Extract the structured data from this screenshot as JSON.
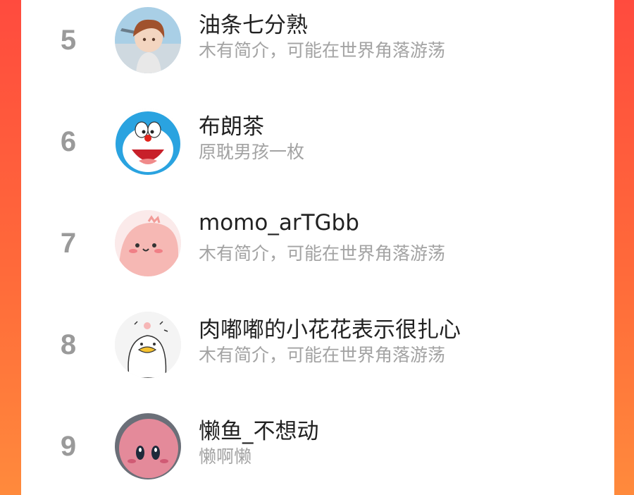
{
  "rankings": [
    {
      "rank": "5",
      "name": "油条七分熟",
      "bio": "木有简介，可能在世界角落游荡",
      "avatar_icon": "anime-boy-avatar"
    },
    {
      "rank": "6",
      "name": "布朗茶",
      "bio": "原耽男孩一枚",
      "avatar_icon": "doraemon-avatar"
    },
    {
      "rank": "7",
      "name": "momo_arTGbb",
      "bio": "木有简介，可能在世界角落游荡",
      "avatar_icon": "pink-blob-avatar"
    },
    {
      "rank": "8",
      "name": "肉嘟嘟的小花花表示很扎心",
      "bio": "木有简介，可能在世界角落游荡",
      "avatar_icon": "white-duck-avatar"
    },
    {
      "rank": "9",
      "name": "懒鱼_不想动",
      "bio": "懒啊懒",
      "avatar_icon": "kirby-plush-avatar"
    }
  ],
  "colors": {
    "background_gradient_top": "#ff4b3e",
    "background_gradient_bottom": "#ff8a3c",
    "rank_gray": "#9a9a9a",
    "bio_gray": "#a3a3a3"
  }
}
